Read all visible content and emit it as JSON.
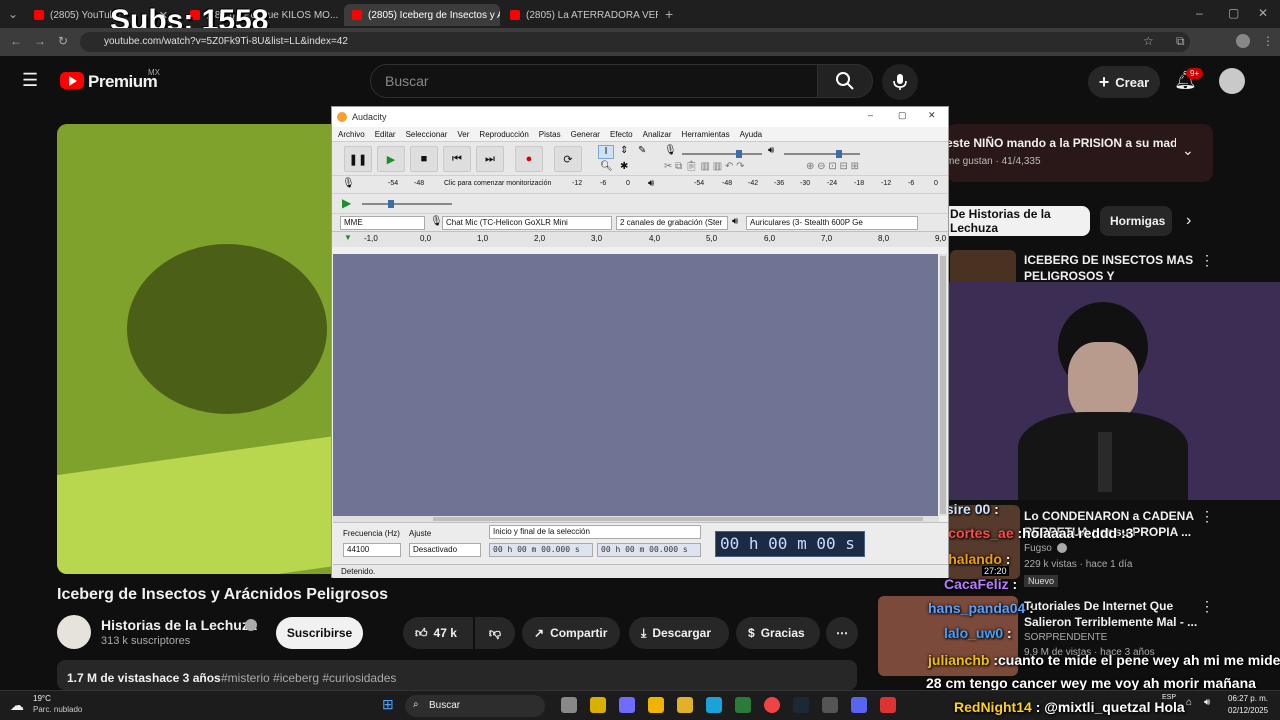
{
  "overlay": {
    "subs": "Subs: 1558"
  },
  "browser": {
    "tabs": [
      {
        "label": "(2805) YouTube"
      },
      {
        "label": "(2805) ¿Por que KILOS MO..."
      },
      {
        "label": "(2805) Iceberg de Insectos y Ar..."
      },
      {
        "label": "(2805) La ATERRADORA VERDAD..."
      }
    ],
    "url": "youtube.com/watch?v=5Z0Fk9Ti-8U&list=LL&index=42"
  },
  "yt": {
    "logo": "Premium",
    "region": "MX",
    "search_placeholder": "Buscar",
    "create": "Crear",
    "notif": "9+"
  },
  "audacity": {
    "title": "Audacity",
    "menu": [
      "Archivo",
      "Editar",
      "Seleccionar",
      "Ver",
      "Reproducción",
      "Pistas",
      "Generar",
      "Efecto",
      "Analizar",
      "Herramientas",
      "Ayuda"
    ],
    "meter_label": "Clic para comenzar monitorización",
    "rec_meter_ticks": [
      "-54",
      "-48",
      "-18",
      "-12",
      "-6",
      "0"
    ],
    "play_meter_ticks": [
      "-54",
      "-48",
      "-42",
      "-36",
      "-30",
      "-24",
      "-18",
      "-12",
      "-6",
      "0"
    ],
    "host": "MME",
    "rec_device": "Chat Mic (TC-Helicon GoXLR Mini",
    "channels": "2 canales de grabación (Ster",
    "play_device": "Auriculares (3- Stealth 600P Ge",
    "ruler": [
      "-1,0",
      "0,0",
      "1,0",
      "2,0",
      "3,0",
      "4,0",
      "5,0",
      "6,0",
      "7,0",
      "8,0",
      "9,0"
    ],
    "freq_label": "Frecuencia (Hz)",
    "freq": "44100",
    "snap_label": "Ajuste",
    "snap": "Desactivado",
    "sel_label": "Inicio y final de la selección",
    "sel_start": "00 h 00 m 00.000 s",
    "sel_end": "00 h 00 m 00.000 s",
    "time": "00 h 00 m 00 s",
    "status": "Detenido."
  },
  "side": {
    "pinned_title": "este NIÑO mando a la PRISION a su mad...",
    "pinned_meta": "me gustan · 41/4,335",
    "chips": [
      "De Historias de la Lechuza",
      "Hormigas"
    ],
    "items": [
      {
        "title": "ICEBERG DE INSECTOS MAS PELIGROSOS Y ATERRADORE...",
        "meta": ""
      },
      {
        "title": "Lo CONDENARON a CADENA PERPETUA por su PROPIA ...",
        "channel": "Fugso",
        "meta": "229 k vistas · hace 1 día",
        "duration": "27:20",
        "badge": "Nuevo"
      },
      {
        "title": "Tutoriales De Internet Que Salieron Terriblemente Mal - ...",
        "channel": "SORPRENDENTE",
        "meta": "9,9 M de vistas · hace 3 años"
      }
    ]
  },
  "chat": [
    {
      "user": "Desire 00",
      "msg": ":"
    },
    {
      "user": "cigcortes_ae",
      "msg": ":holaaaa reddd :3"
    },
    {
      "user": "Inchalando",
      "msg": ":"
    },
    {
      "user": "CacaFeliz",
      "msg": ":"
    },
    {
      "user": "hans_panda04",
      "msg": ":"
    },
    {
      "user": "lalo_uw0",
      "msg": ":"
    },
    {
      "user": "julianchb",
      "msg": ":cuanto te mide el pene wey ah mi me mide"
    },
    {
      "user": "",
      "msg": "28 cm tengo cancer wey me voy ah morir mañana"
    },
    {
      "user": "RedNight14",
      "msg": ": @mixtli_quetzal Hola"
    }
  ],
  "video": {
    "title": "Iceberg de Insectos y Arácnidos Peligrosos",
    "channel": "Historias de la Lechuza",
    "subs": "313 k suscriptores",
    "subscribe": "Suscribirse",
    "likes": "47 k",
    "share": "Compartir",
    "download": "Descargar",
    "thanks": "Gracias",
    "views": "1.7 M de vistas",
    "age": "hace 3 años",
    "tags": "#misterio #iceberg #curiosidades"
  },
  "taskbar": {
    "temp": "19°C",
    "weather": "Parc. nublado",
    "search": "Buscar",
    "lang": "ESP",
    "time": "06:27 p. m.",
    "date": "02/12/2025"
  }
}
